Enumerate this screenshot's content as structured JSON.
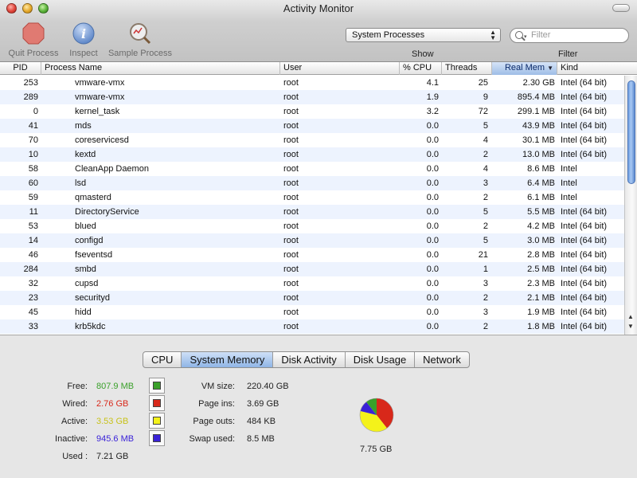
{
  "window": {
    "title": "Activity Monitor"
  },
  "toolbar": {
    "quit_label": "Quit Process",
    "inspect_label": "Inspect",
    "sample_label": "Sample Process",
    "show_label": "Show",
    "filter_label": "Filter",
    "show_select_value": "System Processes",
    "search_placeholder": "Filter"
  },
  "table": {
    "columns": [
      "PID",
      "Process Name",
      "User",
      "% CPU",
      "Threads",
      "Real Mem",
      "Kind"
    ],
    "sorted_column": "Real Mem",
    "rows": [
      {
        "pid": "253",
        "name": "vmware-vmx",
        "user": "root",
        "cpu": "4.1",
        "threads": "25",
        "mem": "2.30 GB",
        "kind": "Intel (64 bit)"
      },
      {
        "pid": "289",
        "name": "vmware-vmx",
        "user": "root",
        "cpu": "1.9",
        "threads": "9",
        "mem": "895.4 MB",
        "kind": "Intel (64 bit)"
      },
      {
        "pid": "0",
        "name": "kernel_task",
        "user": "root",
        "cpu": "3.2",
        "threads": "72",
        "mem": "299.1 MB",
        "kind": "Intel (64 bit)"
      },
      {
        "pid": "41",
        "name": "mds",
        "user": "root",
        "cpu": "0.0",
        "threads": "5",
        "mem": "43.9 MB",
        "kind": "Intel (64 bit)"
      },
      {
        "pid": "70",
        "name": "coreservicesd",
        "user": "root",
        "cpu": "0.0",
        "threads": "4",
        "mem": "30.1 MB",
        "kind": "Intel (64 bit)"
      },
      {
        "pid": "10",
        "name": "kextd",
        "user": "root",
        "cpu": "0.0",
        "threads": "2",
        "mem": "13.0 MB",
        "kind": "Intel (64 bit)"
      },
      {
        "pid": "58",
        "name": "CleanApp Daemon",
        "user": "root",
        "cpu": "0.0",
        "threads": "4",
        "mem": "8.6 MB",
        "kind": "Intel"
      },
      {
        "pid": "60",
        "name": "lsd",
        "user": "root",
        "cpu": "0.0",
        "threads": "3",
        "mem": "6.4 MB",
        "kind": "Intel"
      },
      {
        "pid": "59",
        "name": "qmasterd",
        "user": "root",
        "cpu": "0.0",
        "threads": "2",
        "mem": "6.1 MB",
        "kind": "Intel"
      },
      {
        "pid": "11",
        "name": "DirectoryService",
        "user": "root",
        "cpu": "0.0",
        "threads": "5",
        "mem": "5.5 MB",
        "kind": "Intel (64 bit)"
      },
      {
        "pid": "53",
        "name": "blued",
        "user": "root",
        "cpu": "0.0",
        "threads": "2",
        "mem": "4.2 MB",
        "kind": "Intel (64 bit)"
      },
      {
        "pid": "14",
        "name": "configd",
        "user": "root",
        "cpu": "0.0",
        "threads": "5",
        "mem": "3.0 MB",
        "kind": "Intel (64 bit)"
      },
      {
        "pid": "46",
        "name": "fseventsd",
        "user": "root",
        "cpu": "0.0",
        "threads": "21",
        "mem": "2.8 MB",
        "kind": "Intel (64 bit)"
      },
      {
        "pid": "284",
        "name": "smbd",
        "user": "root",
        "cpu": "0.0",
        "threads": "1",
        "mem": "2.5 MB",
        "kind": "Intel (64 bit)"
      },
      {
        "pid": "32",
        "name": "cupsd",
        "user": "root",
        "cpu": "0.0",
        "threads": "3",
        "mem": "2.3 MB",
        "kind": "Intel (64 bit)"
      },
      {
        "pid": "23",
        "name": "securityd",
        "user": "root",
        "cpu": "0.0",
        "threads": "2",
        "mem": "2.1 MB",
        "kind": "Intel (64 bit)"
      },
      {
        "pid": "45",
        "name": "hidd",
        "user": "root",
        "cpu": "0.0",
        "threads": "3",
        "mem": "1.9 MB",
        "kind": "Intel (64 bit)"
      },
      {
        "pid": "33",
        "name": "krb5kdc",
        "user": "root",
        "cpu": "0.0",
        "threads": "2",
        "mem": "1.8 MB",
        "kind": "Intel (64 bit)"
      }
    ]
  },
  "tabs": [
    "CPU",
    "System Memory",
    "Disk Activity",
    "Disk Usage",
    "Network"
  ],
  "active_tab": "System Memory",
  "memory": {
    "free_label": "Free:",
    "free_value": "807.9 MB",
    "free_color": "#3aa02a",
    "wired_label": "Wired:",
    "wired_value": "2.76 GB",
    "wired_color": "#d8281a",
    "active_label": "Active:",
    "active_value": "3.53 GB",
    "active_color": "#c8c21a",
    "inactive_label": "Inactive:",
    "inactive_value": "945.6 MB",
    "inactive_color": "#3a22d8",
    "used_label": "Used :",
    "used_value": "7.21 GB",
    "vm_size_label": "VM size:",
    "vm_size_value": "220.40 GB",
    "page_ins_label": "Page ins:",
    "page_ins_value": "3.69 GB",
    "page_outs_label": "Page outs:",
    "page_outs_value": "484 KB",
    "swap_used_label": "Swap used:",
    "swap_used_value": "8.5 MB",
    "total_value": "7.75 GB"
  }
}
